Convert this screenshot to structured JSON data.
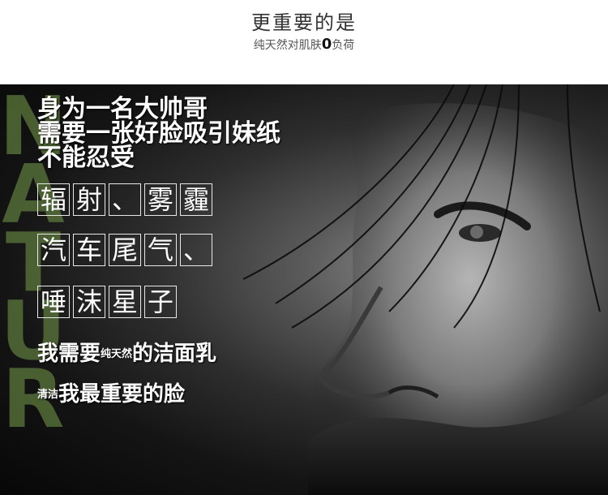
{
  "header": {
    "title": "更重要的是",
    "subtitle_prefix": "纯天然对肌肤",
    "subtitle_zero": "0",
    "subtitle_suffix": "负荷"
  },
  "banner": {
    "vertical_word": [
      "N",
      "A",
      "T",
      "U",
      "R"
    ],
    "headline_lines": [
      "身为一名大帅哥",
      "需要一张好脸吸引妹纸",
      "不能忍受"
    ],
    "boxed_rows": [
      [
        "辐",
        "射",
        "、",
        "雾",
        "霾"
      ],
      [
        "汽",
        "车",
        "尾",
        "气",
        "、"
      ],
      [
        "唾",
        "沫",
        "星",
        "子"
      ]
    ],
    "line4": {
      "prefix": "我需要",
      "small": "纯天然",
      "suffix": "的洁面乳"
    },
    "line5": {
      "small": "清洁",
      "suffix": "我最重要的脸"
    }
  },
  "colors": {
    "accent_green": "#5f7d3d",
    "text_white": "#ffffff",
    "header_text": "#333333"
  }
}
